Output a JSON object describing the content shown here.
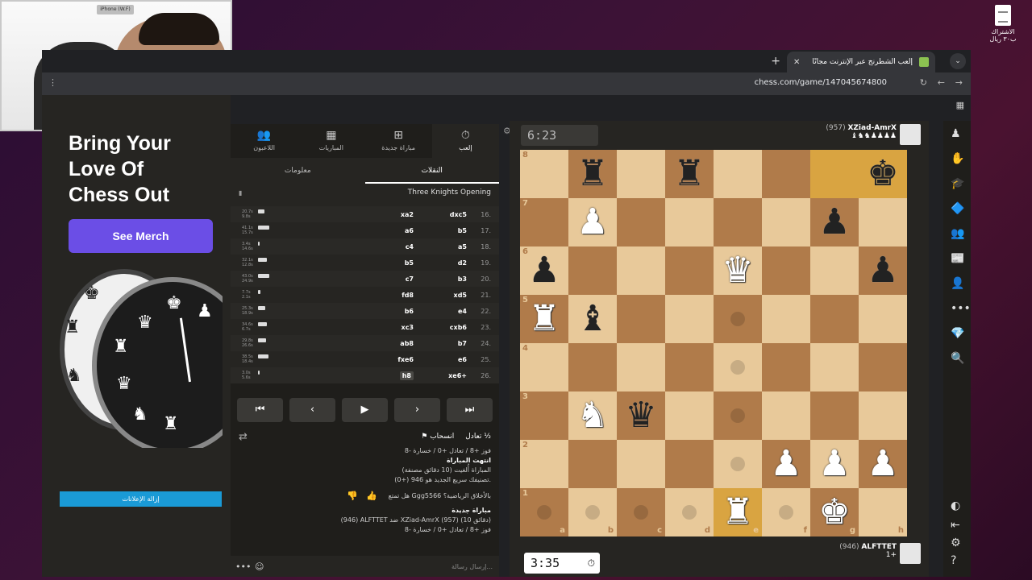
{
  "webcam": {
    "label": "iPhone (W.F)"
  },
  "desktop_icon": {
    "label": "الاشتراك ب٣٠ ريال"
  },
  "browser": {
    "tab_title": "إلعب الشطرنج عبر الإنترنت مجانًا",
    "url": "chess.com/game/147045674800"
  },
  "promo": {
    "title_lines": [
      "Bring Your",
      "Love Of",
      "Chess Out"
    ],
    "button": "See Merch",
    "remove_ads": "إزالة الإعلانات"
  },
  "nav": {
    "tabs": [
      {
        "label": "إلعب",
        "icon": "stopwatch-icon",
        "glyph": "⏱"
      },
      {
        "label": "مباراة جديدة",
        "icon": "plus-icon",
        "glyph": "➕"
      },
      {
        "label": "المباريات",
        "icon": "board-icon",
        "glyph": "▦"
      },
      {
        "label": "اللاعبون",
        "icon": "players-icon",
        "glyph": "👥"
      }
    ],
    "sub_tabs": [
      "النقلات",
      "معلومات"
    ],
    "opening": "Three Knights Opening"
  },
  "moves": [
    {
      "n": "16.",
      "w": "dxc5",
      "b": "xa2",
      "t1": "20.7s",
      "t2": "9.8s",
      "bar": 8
    },
    {
      "n": "17.",
      "w": "b5",
      "b": "a6",
      "t1": "41.1s",
      "t2": "15.7s",
      "bar": 14
    },
    {
      "n": "18.",
      "w": "a5",
      "b": "c4",
      "t1": "3.4s",
      "t2": "14.6s",
      "bar": 2
    },
    {
      "n": "19.",
      "w": "d2",
      "b": "b5",
      "t1": "32.1s",
      "t2": "12.8s",
      "bar": 11
    },
    {
      "n": "20.",
      "w": "b3",
      "b": "c7",
      "t1": "43.0s",
      "t2": "24.9s",
      "bar": 14
    },
    {
      "n": "21.",
      "w": "xd5",
      "b": "fd8",
      "t1": "7.7s",
      "t2": "2.1s",
      "bar": 3
    },
    {
      "n": "22.",
      "w": "e4",
      "b": "b6",
      "t1": "25.3s",
      "t2": "18.9s",
      "bar": 9
    },
    {
      "n": "23.",
      "w": "cxb6",
      "b": "xc3",
      "t1": "34.6s",
      "t2": "6.7s",
      "bar": 11
    },
    {
      "n": "24.",
      "w": "b7",
      "b": "ab8",
      "t1": "29.8s",
      "t2": "26.6s",
      "bar": 10
    },
    {
      "n": "25.",
      "w": "e6",
      "b": "fxe6",
      "t1": "38.5s",
      "t2": "18.4s",
      "bar": 13
    },
    {
      "n": "26.",
      "w": "xe6+",
      "b": "h8",
      "t1": "3.0s",
      "t2": "5.6s",
      "bar": 2
    }
  ],
  "controls": [
    "⏮",
    "‹",
    "▶",
    "›",
    "⏭"
  ],
  "actions": {
    "draw": "تعادل",
    "resign": "انسحاب"
  },
  "chat": {
    "lines": [
      {
        "text": "فوز +8 / تعادل +0 / خسارة -8",
        "bold": false
      },
      {
        "text": "انتهت المباراة",
        "bold": true
      },
      {
        "text": "المباراة أُلغيت (10 دقائق مصنفة)",
        "bold": false
      },
      {
        "text": "تصنيفك سريع الجديد هو 946 (+0).",
        "bold": false
      },
      {
        "text": "هل تمتع Ggg5566 بالأخلاق الرياضية؟",
        "bold": false
      },
      {
        "text": "مباراة جديدة",
        "bold": true
      },
      {
        "text": "(946) ALFTTET ضد XZiad-AmrX (957) (10 دقائق)",
        "bold": false
      },
      {
        "text": "فوز +8 / تعادل +0 / خسارة -8",
        "bold": false
      }
    ],
    "placeholder": "إرسال رسالة..."
  },
  "top_player": {
    "name": "XZiad-AmrX",
    "rating": "(957)",
    "clock": "6:23",
    "captures": "♝♞♞♟♟♟♟"
  },
  "bottom_player": {
    "name": "ALFTTET",
    "rating": "(946)",
    "clock": "3:35",
    "material": "1+"
  },
  "board": {
    "pieces": [
      [
        "",
        "bR",
        "",
        "bR",
        "",
        "",
        "",
        "bK"
      ],
      [
        "",
        "wP",
        "",
        "",
        "",
        "",
        "bP",
        ""
      ],
      [
        "bP",
        "",
        "",
        "",
        "wQ",
        "",
        "",
        "bP"
      ],
      [
        "wR",
        "bB",
        "",
        "",
        "",
        "",
        "",
        ""
      ],
      [
        "",
        "",
        "",
        "",
        "",
        "",
        "",
        ""
      ],
      [
        "",
        "wN",
        "bQ",
        "",
        "",
        "",
        "",
        ""
      ],
      [
        "",
        "",
        "",
        "",
        "",
        "wP",
        "wP",
        "wP"
      ],
      [
        "",
        "",
        "",
        "",
        "wR",
        "",
        "wK",
        ""
      ]
    ],
    "highlight": [
      "g8",
      "h8",
      "e1"
    ],
    "dots": [
      "e5",
      "e4",
      "e3",
      "e2",
      "a1",
      "b1",
      "c1",
      "d1",
      "f1"
    ],
    "files": [
      "a",
      "b",
      "c",
      "d",
      "e",
      "f",
      "g",
      "h"
    ],
    "ranks": [
      "8",
      "7",
      "6",
      "5",
      "4",
      "3",
      "2",
      "1"
    ]
  },
  "rail_icons": [
    {
      "name": "pawn-icon",
      "glyph": "♟"
    },
    {
      "name": "puzzle-icon",
      "glyph": "✋"
    },
    {
      "name": "learn-icon",
      "glyph": "🎓"
    },
    {
      "name": "watch-icon",
      "glyph": "🔷"
    },
    {
      "name": "friends-icon",
      "glyph": "👥"
    },
    {
      "name": "news-icon",
      "glyph": "📰"
    },
    {
      "name": "social-icon",
      "glyph": "👤"
    },
    {
      "name": "more-icon",
      "glyph": "•••"
    },
    {
      "name": "diamond-icon",
      "glyph": "💎"
    },
    {
      "name": "search-icon",
      "glyph": "🔍"
    }
  ]
}
